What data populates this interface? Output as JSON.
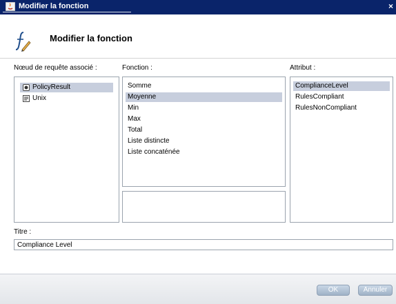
{
  "window": {
    "title": "Modifier la fonction",
    "close": "×"
  },
  "header": {
    "title": "Modifier la fonction"
  },
  "labels": {
    "node": "Nœud de requête associé :",
    "function": "Fonction :",
    "attribute": "Attribut :",
    "title": "Titre :"
  },
  "nodes": [
    {
      "label": "PolicyResult",
      "icon": "policy-result-icon",
      "selected": true
    },
    {
      "label": "Unix",
      "icon": "unix-node-icon",
      "selected": false
    }
  ],
  "functions": [
    {
      "label": "Somme",
      "selected": false
    },
    {
      "label": "Moyenne",
      "selected": true
    },
    {
      "label": "Min",
      "selected": false
    },
    {
      "label": "Max",
      "selected": false
    },
    {
      "label": "Total",
      "selected": false
    },
    {
      "label": "Liste distincte",
      "selected": false
    },
    {
      "label": "Liste concaténée",
      "selected": false
    }
  ],
  "attributes": [
    {
      "label": "ComplianceLevel",
      "selected": true
    },
    {
      "label": "RulesCompliant",
      "selected": false
    },
    {
      "label": "RulesNonCompliant",
      "selected": false
    }
  ],
  "title_field": {
    "value": "Compliance Level"
  },
  "buttons": {
    "ok": "OK",
    "cancel": "Annuler"
  },
  "colors": {
    "titlebar": "#0a246a",
    "selection": "#c7cedd",
    "button": "#9fb2c7"
  }
}
